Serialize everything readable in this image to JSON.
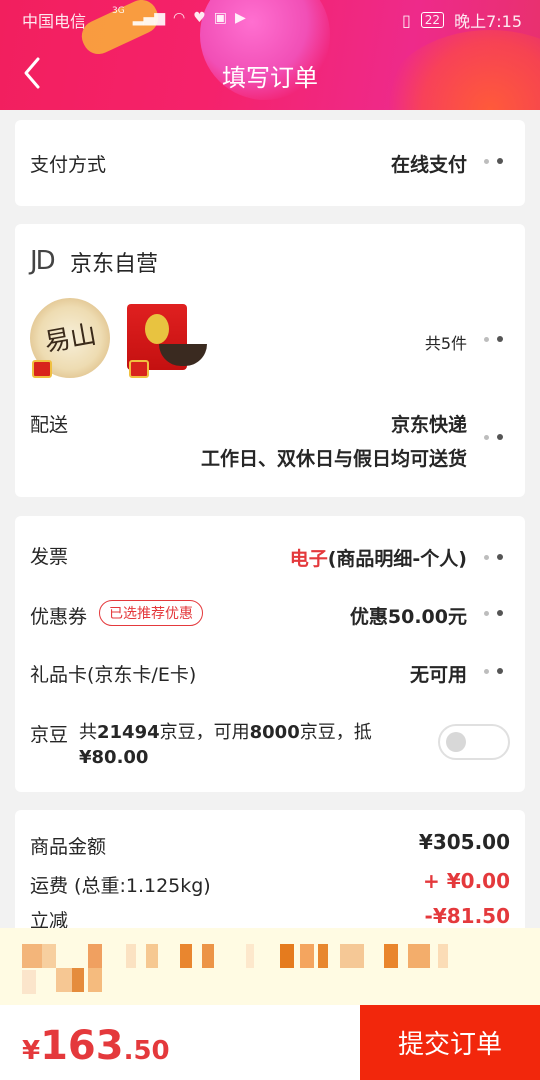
{
  "status_bar": {
    "carrier": "中国电信",
    "network": "3G",
    "battery": "22",
    "time": "晚上7:15"
  },
  "header": {
    "title": "填写订单",
    "back_icon": "chevron-left-icon"
  },
  "payment": {
    "label": "支付方式",
    "value": "在线支付"
  },
  "shop": {
    "logo": "JD",
    "name": "京东自营",
    "products": [
      {
        "name": "tea-cake",
        "text": "易山"
      },
      {
        "name": "tea-tin"
      }
    ],
    "count_text": "共5件",
    "delivery_label": "配送",
    "delivery_method": "京东快递",
    "delivery_time": "工作日、双休日与假日均可送货"
  },
  "invoice": {
    "label": "发票",
    "value_red": "电子",
    "value_rest": "(商品明细-个人)"
  },
  "coupon": {
    "label": "优惠券",
    "tag": "已选推荐优惠",
    "value": "优惠50.00元"
  },
  "giftcard": {
    "label": "礼品卡(京东卡/E卡)",
    "value": "无可用"
  },
  "jingdou": {
    "label": "京豆",
    "desc_prefix": "共",
    "total": "21494",
    "desc_mid": "京豆，可用",
    "usable": "8000",
    "desc_end": "京豆，抵",
    "deduct": "¥80.00",
    "enabled": false
  },
  "summary": {
    "items": [
      {
        "label": "商品金额",
        "value": "¥305.00",
        "color": "#262626"
      },
      {
        "label": "运费 (总重:1.125kg)",
        "value": "+ ¥0.00",
        "color": "#e4393c"
      },
      {
        "label": "立减",
        "value": "-¥81.50",
        "color": "#e4393c"
      }
    ]
  },
  "footer": {
    "currency": "¥",
    "total_int": "163",
    "total_dec": ".50",
    "submit_label": "提交订单"
  },
  "colors": {
    "accent": "#f2270c",
    "header": "#f5226b",
    "price": "#e4393c"
  }
}
